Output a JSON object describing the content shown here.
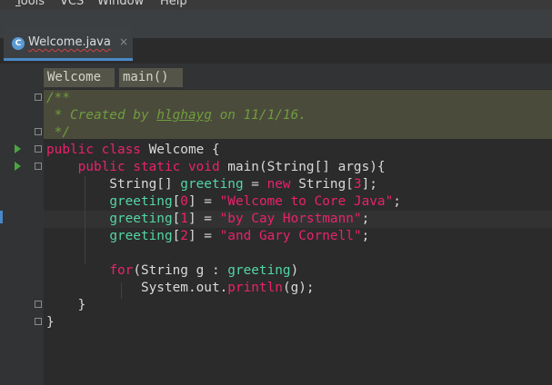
{
  "menubar": {
    "items": [
      {
        "label": "Tools",
        "mnemonic": "T"
      },
      {
        "label": "VCS",
        "mnemonic": "S"
      },
      {
        "label": "Window",
        "mnemonic": "W"
      },
      {
        "label": "Help",
        "mnemonic": "H"
      }
    ]
  },
  "tab": {
    "icon": "java-class-icon",
    "icon_glyph": "C",
    "title": "Welcome.java",
    "close_glyph": "×"
  },
  "breadcrumbs": [
    "Welcome",
    "main()"
  ],
  "editor": {
    "lines": [
      "/**",
      " * Created by hlghayg on 11/1/16.",
      " */",
      "public class Welcome {",
      "    public static void main(String[] args){",
      "        String[] greeting = new String[3];",
      "        greeting[0] = \"Welcome to Core Java\";",
      "        greeting[1] = \"by Cay Horstmann\";",
      "        greeting[2] = \"and Gary Cornell\";",
      "",
      "        for(String g : greeting)",
      "            System.out.println(g);",
      "    }",
      "}"
    ]
  },
  "colors": {
    "keyword": "#e8236b",
    "string": "#e8236b",
    "variable": "#53d6a5",
    "comment": "#6f9d3c",
    "background": "#2b2b2b",
    "caret_line": "#323232",
    "doc_highlight": "#4b4b3c"
  }
}
